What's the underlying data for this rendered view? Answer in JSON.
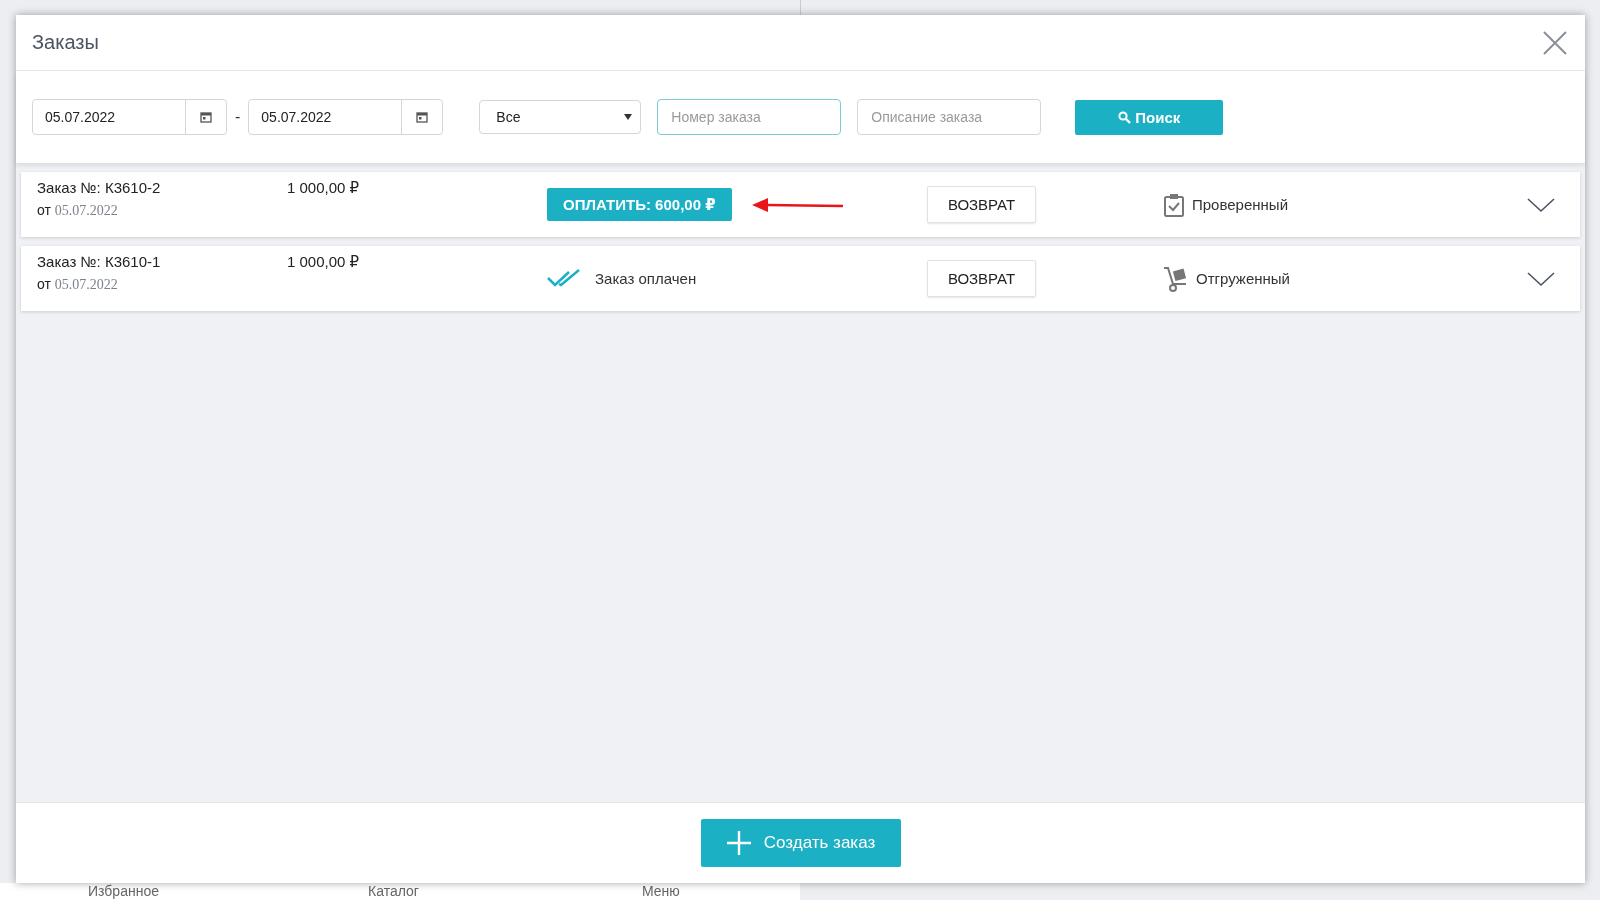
{
  "window": {
    "title": "Заказы"
  },
  "filters": {
    "date_from": "05.07.2022",
    "separator": "-",
    "date_to": "05.07.2022",
    "status": "Все",
    "order_number": {
      "placeholder": "Номер заказа",
      "focused": true
    },
    "description": {
      "placeholder": "Описание заказа",
      "focused": false
    },
    "search_button": "Поиск"
  },
  "orders": [
    {
      "number_label": "Заказ №: К3610-2",
      "date_prefix": "от",
      "date": "05.07.2022",
      "amount": "1 000,00 ₽",
      "payment": {
        "kind": "button",
        "text": "ОПЛАТИТЬ: 600,00 ₽"
      },
      "annotation_arrow": true,
      "return_button": "ВОЗВРАТ",
      "status": {
        "kind": "checked",
        "text": "Проверенный"
      }
    },
    {
      "number_label": "Заказ №: К3610-1",
      "date_prefix": "от",
      "date": "05.07.2022",
      "amount": "1 000,00 ₽",
      "payment": {
        "kind": "paid",
        "text": "Заказ оплачен"
      },
      "annotation_arrow": false,
      "return_button": "ВОЗВРАТ",
      "status": {
        "kind": "shipped",
        "text": "Отгруженный"
      }
    }
  ],
  "footer": {
    "create_button": "Создать заказ"
  },
  "background_nav": [
    "Избранное",
    "Каталог",
    "Меню"
  ]
}
